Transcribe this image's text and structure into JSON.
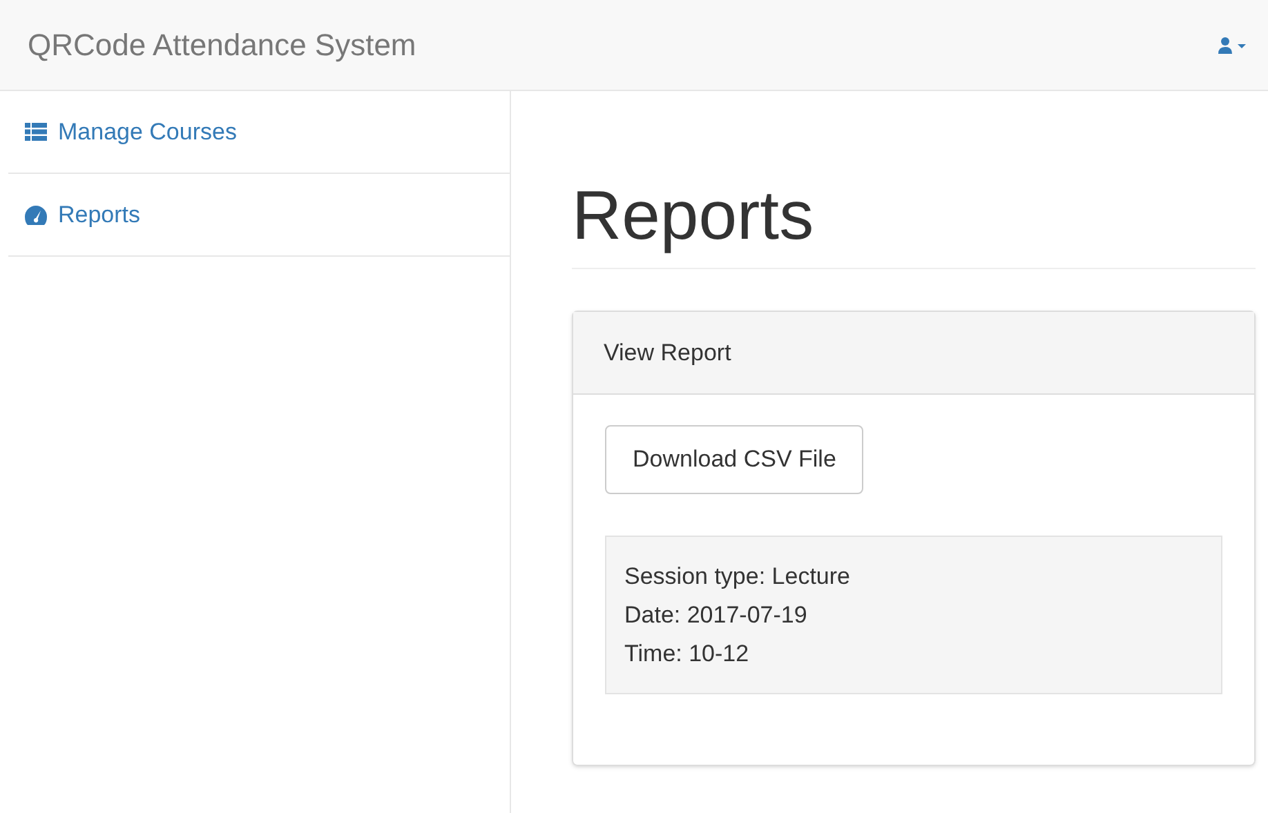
{
  "navbar": {
    "brand": "QRCode Attendance System"
  },
  "sidebar": {
    "items": [
      {
        "label": "Manage Courses",
        "kind": "list"
      },
      {
        "label": "Reports",
        "kind": "dashboard"
      }
    ]
  },
  "page": {
    "title": "Reports"
  },
  "panel": {
    "title": "View Report",
    "button": "Download CSV File",
    "details": [
      "Session type: Lecture",
      "Date: 2017-07-19",
      "Time: 10-12"
    ]
  }
}
